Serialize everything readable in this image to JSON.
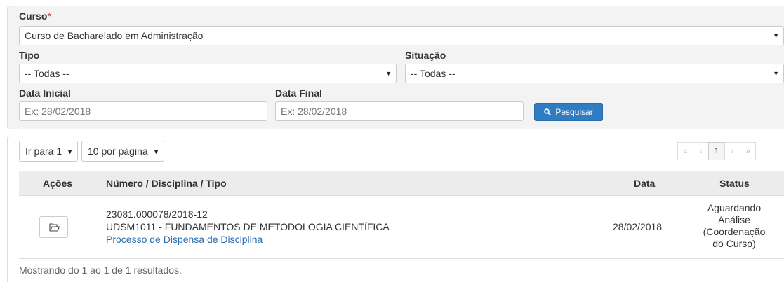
{
  "filters": {
    "curso": {
      "label": "Curso",
      "required_mark": "*",
      "value": "Curso de Bacharelado em Administração"
    },
    "tipo": {
      "label": "Tipo",
      "value": "-- Todas --"
    },
    "situacao": {
      "label": "Situação",
      "value": "-- Todas --"
    },
    "data_inicial": {
      "label": "Data Inicial",
      "placeholder": "Ex: 28/02/2018"
    },
    "data_final": {
      "label": "Data Final",
      "placeholder": "Ex: 28/02/2018"
    },
    "search_button": {
      "icon": "search-icon",
      "label": "Pesquisar"
    }
  },
  "toolbar": {
    "goto_page": "Ir para 1",
    "per_page": "10 por página"
  },
  "pagination": {
    "first": "«",
    "prev": "‹",
    "current": "1",
    "next": "›",
    "last": "»"
  },
  "table": {
    "columns": [
      "Ações",
      "Número / Disciplina / Tipo",
      "Data",
      "Status"
    ],
    "rows": [
      {
        "action_icon": "folder-open-icon",
        "numero": "23081.000078/2018-12",
        "disciplina": "UDSM1011 - FUNDAMENTOS DE METODOLOGIA CIENTÍFICA",
        "tipo": "Processo de Dispensa de Disciplina",
        "data": "28/02/2018",
        "status": [
          "Aguardando",
          "Análise",
          "(Coordenação",
          "do Curso)"
        ]
      }
    ]
  },
  "footer": {
    "summary": "Mostrando do 1 ao 1 de 1 resultados."
  },
  "colors": {
    "primary_button": "#2f7cc3",
    "link": "#2a6eb0",
    "required": "#c9302c",
    "table_header": "#ececec"
  }
}
